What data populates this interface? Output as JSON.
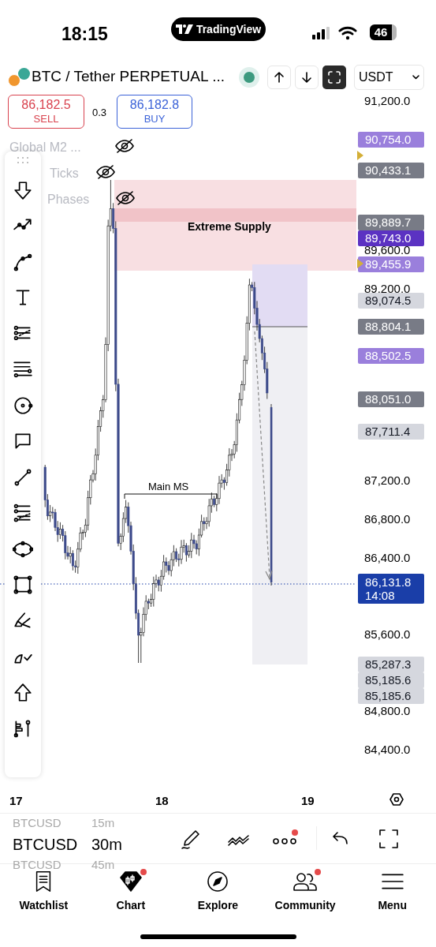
{
  "status_bar": {
    "time": "18:15",
    "app_pill": "TradingView",
    "battery": "46"
  },
  "header": {
    "symbol": "BTC / Tether PERPETUAL ...",
    "currency": "USDT"
  },
  "trade": {
    "sell_price": "86,182.5",
    "sell_label": "SELL",
    "spread": "0.3",
    "buy_price": "86,182.8",
    "buy_label": "BUY"
  },
  "legend": [
    {
      "label": "Global M2 ...",
      "hidden": true
    },
    {
      "label": "Ticks",
      "hidden": true
    },
    {
      "label": "Phases",
      "hidden": true
    }
  ],
  "chart": {
    "price_axis": [
      "91,200.0",
      "89,600.0",
      "89,200.0",
      "87,200.0",
      "86,800.0",
      "86,400.0",
      "85,600.0",
      "84,800.0",
      "84,400.0"
    ],
    "price_badges": [
      {
        "text": "90,754.0",
        "color": "#9a7fdc"
      },
      {
        "text": "90,433.1",
        "color": "#787b86"
      },
      {
        "text": "89,889.7",
        "color": "#787b86"
      },
      {
        "text": "89,743.0",
        "color": "#5b32c2"
      },
      {
        "text": "89,455.9",
        "color": "#9a7fdc"
      },
      {
        "text": "89,074.5",
        "color": "#d5d7de"
      },
      {
        "text": "88,804.1",
        "color": "#787b86"
      },
      {
        "text": "88,502.5",
        "color": "#9a7fdc"
      },
      {
        "text": "88,051.0",
        "color": "#787b86"
      },
      {
        "text": "87,711.4",
        "color": "#d5d7de"
      },
      {
        "text": "85,287.3",
        "color": "#d5d7de"
      },
      {
        "text": "85,185.6",
        "color": "#d5d7de"
      },
      {
        "text": "85,185.6",
        "color": "#d5d7de"
      }
    ],
    "current_price": {
      "price": "86,131.8",
      "countdown": "14:08"
    },
    "zone_label": "Extreme Supply",
    "structure_label": "Main MS",
    "time_axis": [
      "17",
      "18",
      "19"
    ]
  },
  "bottom_toolbar": {
    "symbols": [
      {
        "symbol": "BTCUSD",
        "interval": "15m",
        "selected": false
      },
      {
        "symbol": "BTCUSD",
        "interval": "30m",
        "selected": true
      },
      {
        "symbol": "BTCUSD",
        "interval": "45m",
        "selected": false
      }
    ],
    "more_badge": true
  },
  "nav": [
    {
      "label": "Watchlist",
      "badge": false
    },
    {
      "label": "Chart",
      "badge": true
    },
    {
      "label": "Explore",
      "badge": false
    },
    {
      "label": "Community",
      "badge": true
    },
    {
      "label": "Menu",
      "badge": false
    }
  ]
}
